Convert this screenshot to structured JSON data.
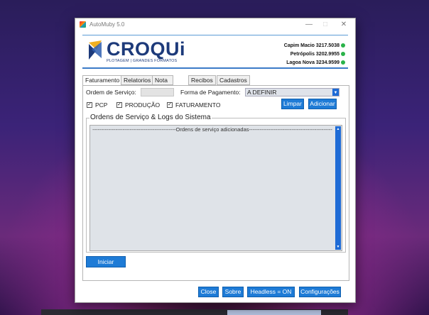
{
  "window": {
    "title": "AutoMuby 5.0"
  },
  "brand": {
    "name": "CROQUi",
    "tagline": "PLOTAGEM | GRANDES FORMATOS"
  },
  "contacts": [
    {
      "label": "Capim Macio 3217.5038"
    },
    {
      "label": "Petrópolis 3202.9955"
    },
    {
      "label": "Lagoa Nova 3234.9599"
    }
  ],
  "tabs": [
    {
      "label": "Faturamento",
      "active": true
    },
    {
      "label": "Relatorios"
    },
    {
      "label": "Nota Fiscal"
    },
    {
      "label": "Recibos"
    },
    {
      "label": "Cadastros"
    }
  ],
  "form": {
    "ordem_label": "Ordem de Serviço:",
    "ordem_value": "",
    "pagamento_label": "Forma de Pagamento:",
    "pagamento_value": "A DEFINIR"
  },
  "checkboxes": [
    {
      "label": "PCP",
      "checked": true
    },
    {
      "label": "PRODUÇÃO",
      "checked": true
    },
    {
      "label": "FATURAMENTO",
      "checked": true
    }
  ],
  "buttons": {
    "limpar": "Limpar",
    "adicionar": "Adicionar",
    "iniciar": "Iniciar",
    "close": "Close",
    "sobre": "Sobre",
    "headless": "Headless = ON",
    "configuracoes": "Configurações"
  },
  "logs": {
    "group_title": "Ordens de Serviço & Logs do Sistema",
    "first_line": "-----------------------------------------------Ordens de serviço adicionadas-----------------------------------------------"
  },
  "colors": {
    "accent": "#1e7bd6",
    "brand": "#1d3a7a",
    "whatsapp": "#2bb34a"
  }
}
